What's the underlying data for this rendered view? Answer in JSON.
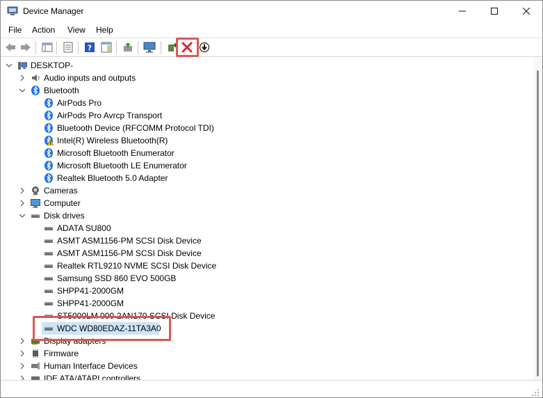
{
  "window": {
    "title": "Device Manager"
  },
  "menu": [
    "File",
    "Action",
    "View",
    "Help"
  ],
  "tree": {
    "root": "DESKTOP-",
    "categories": [
      {
        "label": "Audio inputs and outputs",
        "icon": "speaker-icon",
        "expanded": false
      },
      {
        "label": "Bluetooth",
        "icon": "bluetooth-icon",
        "expanded": true,
        "children": [
          {
            "label": "AirPods Pro",
            "icon": "bluetooth-icon"
          },
          {
            "label": "AirPods Pro Avrcp Transport",
            "icon": "bluetooth-icon"
          },
          {
            "label": "Bluetooth Device (RFCOMM Protocol TDI)",
            "icon": "bluetooth-icon"
          },
          {
            "label": "Intel(R) Wireless Bluetooth(R)",
            "icon": "bluetooth-warning-icon"
          },
          {
            "label": "Microsoft Bluetooth Enumerator",
            "icon": "bluetooth-icon"
          },
          {
            "label": "Microsoft Bluetooth LE Enumerator",
            "icon": "bluetooth-icon"
          },
          {
            "label": "Realtek Bluetooth 5.0 Adapter",
            "icon": "bluetooth-icon"
          }
        ]
      },
      {
        "label": "Cameras",
        "icon": "camera-icon",
        "expanded": false
      },
      {
        "label": "Computer",
        "icon": "monitor-icon",
        "expanded": false
      },
      {
        "label": "Disk drives",
        "icon": "disk-icon",
        "expanded": true,
        "children": [
          {
            "label": "ADATA SU800",
            "icon": "disk-icon"
          },
          {
            "label": "ASMT ASM1156-PM SCSI Disk Device",
            "icon": "disk-icon"
          },
          {
            "label": "ASMT ASM1156-PM SCSI Disk Device",
            "icon": "disk-icon"
          },
          {
            "label": "Realtek RTL9210 NVME SCSI Disk Device",
            "icon": "disk-icon"
          },
          {
            "label": "Samsung SSD 860 EVO 500GB",
            "icon": "disk-icon"
          },
          {
            "label": "SHPP41-2000GM",
            "icon": "disk-icon"
          },
          {
            "label": "SHPP41-2000GM",
            "icon": "disk-icon"
          },
          {
            "label": "ST5000LM 000-2AN170 SCSI Disk Device",
            "icon": "disk-icon"
          },
          {
            "label": "WDC WD80EDAZ-11TA3A0",
            "icon": "disk-icon",
            "selected": true
          }
        ]
      },
      {
        "label": "Display adapters",
        "icon": "display-adapter-icon",
        "expanded": false
      },
      {
        "label": "Firmware",
        "icon": "chip-icon",
        "expanded": false
      },
      {
        "label": "Human Interface Devices",
        "icon": "hid-icon",
        "expanded": false
      },
      {
        "label": "IDE ATA/ATAPI controllers",
        "icon": "controller-icon",
        "expanded": false
      }
    ]
  },
  "colors": {
    "selection": "#cce4f7",
    "highlight": "#e05555",
    "bluetooth": "#1e73e8",
    "uninstall": "#e0262c"
  }
}
